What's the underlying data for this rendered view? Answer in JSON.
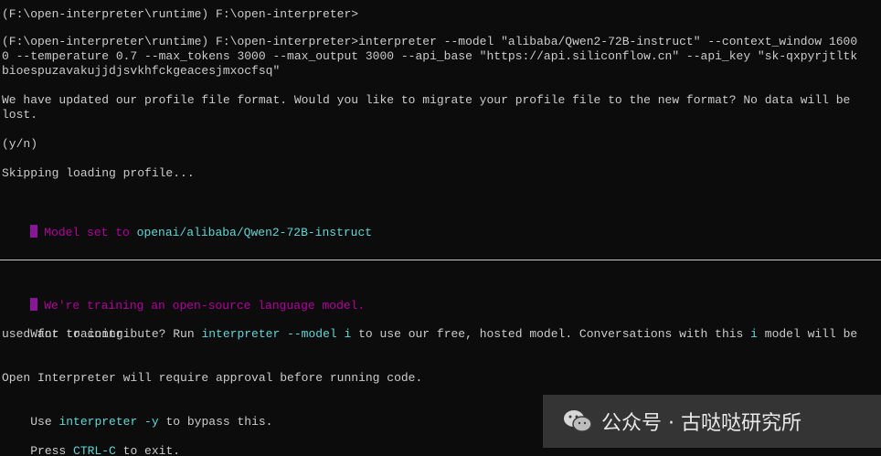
{
  "terminal": {
    "lines": [
      {
        "id": "l1",
        "text": "(F:\\open-interpreter\\runtime) F:\\open-interpreter>"
      },
      {
        "id": "l2",
        "text": "(F:\\open-interpreter\\runtime) F:\\open-interpreter>interpreter --model \"alibaba/Qwen2-72B-instruct\" --context_window 1600"
      },
      {
        "id": "l3",
        "text": "0 --temperature 0.7 --max_tokens 3000 --max_output 3000 --api_base \"https://api.siliconflow.cn\" --api_key \"sk-qxpyrjtltk"
      },
      {
        "id": "l4",
        "text": "bioespuzavakujjdjsvkhfckgeacesjmxocfsq\""
      },
      {
        "id": "l5",
        "text": "We have updated our profile file format. Would you like to migrate your profile file to the new format? No data will be"
      },
      {
        "id": "l6",
        "text": "lost."
      },
      {
        "id": "l7",
        "text": "(y/n)"
      },
      {
        "id": "l8",
        "text": "Skipping loading profile..."
      }
    ],
    "model_set": {
      "prefix": "Model set to ",
      "model": "openai/alibaba/Qwen2-72B-instruct"
    },
    "training_notice": "We're training an open-source language model.",
    "contribute": {
      "p1": "Want to contribute? Run ",
      "cmd": "interpreter --model i",
      "p2": " to use our free, hosted model. Conversations with this ",
      "i": "i",
      "p3": " model will be",
      "line2": "used for training."
    },
    "approval": "Open Interpreter will require approval before running code.",
    "bypass": {
      "p1": "Use ",
      "cmd": "interpreter -y",
      "p2": " to bypass this."
    },
    "exit": {
      "p1": "Press ",
      "key": "CTRL-C",
      "p2": " to exit."
    }
  },
  "watermark": {
    "text": "公众号 · 古哒哒研究所",
    "icon": "wechat-icon"
  }
}
